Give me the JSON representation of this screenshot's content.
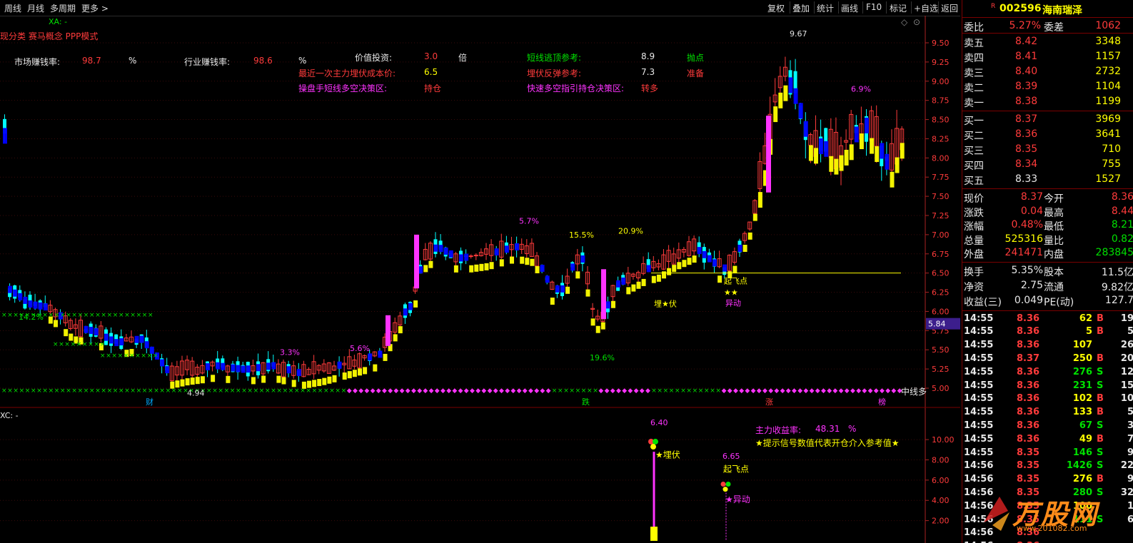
{
  "toolbar": {
    "left": [
      "周线",
      "月线",
      "多周期",
      "更多 >"
    ],
    "right": [
      "复权",
      "叠加",
      "统计",
      "画线",
      "F10",
      "标记",
      "+自选",
      "返回"
    ]
  },
  "chart_header": {
    "xa_label": "XA: -",
    "subtitle": "现分类 赛马概念 PPP模式"
  },
  "indicators": {
    "market_rate_label": "市场赚钱率:",
    "market_rate_value": "98.7",
    "market_rate_unit": "%",
    "industry_rate_label": "行业赚钱率:",
    "industry_rate_value": "98.6",
    "industry_rate_unit": "%",
    "value_invest_label": "价值投资:",
    "value_invest_value": "3.0",
    "value_invest_unit": "倍",
    "cost_price_label": "最近一次主力埋伏成本价:",
    "cost_price_value": "6.5",
    "strategy_label": "操盘手短线多空决策区:",
    "strategy_value": "持仓",
    "top_ref_label": "短线逃顶参考:",
    "top_ref_value": "8.9",
    "top_ref_action": "抛点",
    "rebound_ref_label": "埋伏反弹参考:",
    "rebound_ref_value": "7.3",
    "rebound_ref_action": "准备",
    "quick_label": "快速多空指引持仓决策区:",
    "quick_value": "转多"
  },
  "chart_data": {
    "type": "candlestick",
    "y_ticks": [
      "9.50",
      "9.25",
      "9.00",
      "8.75",
      "8.50",
      "8.25",
      "8.00",
      "7.75",
      "7.50",
      "7.25",
      "7.00",
      "6.75",
      "6.50",
      "6.25",
      "6.00",
      "5.75",
      "5.50",
      "5.25",
      "5.00"
    ],
    "ylim": [
      4.9,
      9.75
    ],
    "current_price_tag": "5.84",
    "support_line": 6.5,
    "annotations": [
      {
        "text": "14.2%",
        "color": "#00e000"
      },
      {
        "text": "3.3%",
        "color": "#ff33ff"
      },
      {
        "text": "5.6%",
        "color": "#ff33ff"
      },
      {
        "text": "5.7%",
        "color": "#ff33ff"
      },
      {
        "text": "15.5%",
        "color": "#ffff00"
      },
      {
        "text": "20.9%",
        "color": "#ffff00"
      },
      {
        "text": "19.6%",
        "color": "#00e000"
      },
      {
        "text": "6.9%",
        "color": "#ff33ff"
      },
      {
        "text": "9.67",
        "color": "#e0e0e0"
      },
      {
        "text": "4.94",
        "color": "#e0e0e0"
      },
      {
        "text": "埋★伏",
        "color": "#ffff00"
      },
      {
        "text": "起飞点",
        "color": "#ffff00"
      },
      {
        "text": "★★",
        "color": "#ffff00"
      },
      {
        "text": "异动",
        "color": "#ff33ff"
      }
    ],
    "bottom_flags": [
      "财",
      "跌",
      "涨",
      "榜"
    ],
    "trend_label": "中线多"
  },
  "sub_chart": {
    "label": "XC: -",
    "y_ticks": [
      "10.00",
      "8.00",
      "6.00",
      "4.00",
      "2.00"
    ],
    "ylim": [
      0,
      11.2
    ],
    "signals": [
      {
        "value": "6.40",
        "label": "★埋伏",
        "value_color": "#ff33ff",
        "label_color": "#ffff00"
      },
      {
        "value": "6.65",
        "label_top": "起飞点",
        "label": "★异动",
        "value_color": "#ff33ff",
        "label_color": "#ff33ff"
      }
    ],
    "info1_label": "主力收益率:",
    "info1_value": "48.31",
    "info1_unit": "%",
    "info2": "★提示信号数值代表开仓介入参考值★"
  },
  "stock": {
    "code": "002596",
    "name": "海南瑞泽",
    "r_badge": "R",
    "weibi_label": "委比",
    "weibi_value": "5.27%",
    "weicha_label": "委差",
    "weicha_value": "1062",
    "asks": [
      {
        "label": "卖五",
        "price": "8.42",
        "vol": "3348"
      },
      {
        "label": "卖四",
        "price": "8.41",
        "vol": "1157"
      },
      {
        "label": "卖三",
        "price": "8.40",
        "vol": "2732"
      },
      {
        "label": "卖二",
        "price": "8.39",
        "vol": "1104"
      },
      {
        "label": "卖一",
        "price": "8.38",
        "vol": "1199"
      }
    ],
    "bids": [
      {
        "label": "买一",
        "price": "8.37",
        "vol": "3969"
      },
      {
        "label": "买二",
        "price": "8.36",
        "vol": "3641"
      },
      {
        "label": "买三",
        "price": "8.35",
        "vol": "710"
      },
      {
        "label": "买四",
        "price": "8.34",
        "vol": "755"
      },
      {
        "label": "买五",
        "price": "8.33",
        "vol": "1527"
      }
    ],
    "stats": [
      {
        "l1": "现价",
        "v1": "8.37",
        "c1": "#ff3b3b",
        "l2": "今开",
        "v2": "8.36",
        "c2": "#ff3b3b"
      },
      {
        "l1": "涨跌",
        "v1": "0.04",
        "c1": "#ff3b3b",
        "l2": "最高",
        "v2": "8.44",
        "c2": "#ff3b3b"
      },
      {
        "l1": "涨幅",
        "v1": "0.48%",
        "c1": "#ff3b3b",
        "l2": "最低",
        "v2": "8.21",
        "c2": "#00e000"
      },
      {
        "l1": "总量",
        "v1": "525316",
        "c1": "#ffff00",
        "l2": "量比",
        "v2": "0.82",
        "c2": "#00e000"
      },
      {
        "l1": "外盘",
        "v1": "241471",
        "c1": "#ff3b3b",
        "l2": "内盘",
        "v2": "283845",
        "c2": "#00e000"
      }
    ],
    "stats2": [
      {
        "l1": "换手",
        "v1": "5.35%",
        "l2": "股本",
        "v2": "11.5亿"
      },
      {
        "l1": "净资",
        "v1": "2.75",
        "l2": "流通",
        "v2": "9.82亿"
      },
      {
        "l1": "收益(三)",
        "v1": "0.049",
        "l2": "PE(动)",
        "v2": "127.7"
      }
    ],
    "ticks": [
      {
        "t": "14:55",
        "p": "8.36",
        "v": "62",
        "s": "B",
        "n": "19"
      },
      {
        "t": "14:55",
        "p": "8.36",
        "v": "5",
        "s": "B",
        "n": "5"
      },
      {
        "t": "14:55",
        "p": "8.36",
        "v": "107",
        "s": "",
        "n": "26"
      },
      {
        "t": "14:55",
        "p": "8.37",
        "v": "250",
        "s": "B",
        "n": "20"
      },
      {
        "t": "14:55",
        "p": "8.36",
        "v": "276",
        "s": "S",
        "n": "12"
      },
      {
        "t": "14:55",
        "p": "8.36",
        "v": "231",
        "s": "S",
        "n": "15"
      },
      {
        "t": "14:55",
        "p": "8.36",
        "v": "102",
        "s": "B",
        "n": "10"
      },
      {
        "t": "14:55",
        "p": "8.36",
        "v": "133",
        "s": "B",
        "n": "5"
      },
      {
        "t": "14:55",
        "p": "8.36",
        "v": "67",
        "s": "S",
        "n": "3"
      },
      {
        "t": "14:55",
        "p": "8.36",
        "v": "49",
        "s": "B",
        "n": "7"
      },
      {
        "t": "14:55",
        "p": "8.35",
        "v": "146",
        "s": "S",
        "n": "9"
      },
      {
        "t": "14:56",
        "p": "8.35",
        "v": "1426",
        "s": "S",
        "n": "22"
      },
      {
        "t": "14:56",
        "p": "8.35",
        "v": "276",
        "s": "B",
        "n": "9"
      },
      {
        "t": "14:56",
        "p": "8.35",
        "v": "280",
        "s": "S",
        "n": "32"
      },
      {
        "t": "14:56",
        "p": "8.35",
        "v": "100",
        "s": "",
        "n": "1"
      },
      {
        "t": "14:56",
        "p": "8.35",
        "v": "111",
        "s": "S",
        "n": "6"
      },
      {
        "t": "14:56",
        "p": "8.36",
        "v": "",
        "s": "",
        "n": ""
      },
      {
        "t": "14:56",
        "p": "8.36",
        "v": "",
        "s": "",
        "n": ""
      },
      {
        "t": "14:56",
        "p": "8.36",
        "v": "221",
        "s": "B",
        "n": ""
      }
    ],
    "watermark": "万股网",
    "watermark_sub": "www.201082.com"
  },
  "colors": {
    "up": "#ff3b3b",
    "down": "#00ffff",
    "bull_bar": "#ffff00",
    "bear_bar": "#0000ff",
    "magenta": "#ff33ff",
    "border": "#7a0000"
  }
}
